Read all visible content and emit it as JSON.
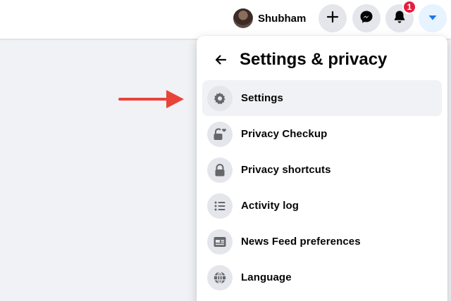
{
  "topbar": {
    "profile_name": "Shubham",
    "notification_count": "1",
    "icons": [
      "plus-icon",
      "messenger-icon",
      "bell-icon",
      "caret-down-icon"
    ]
  },
  "menu": {
    "title": "Settings & privacy",
    "items": [
      {
        "label": "Settings",
        "icon": "gear-icon"
      },
      {
        "label": "Privacy Checkup",
        "icon": "lock-heart-icon"
      },
      {
        "label": "Privacy shortcuts",
        "icon": "lock-icon"
      },
      {
        "label": "Activity log",
        "icon": "list-icon"
      },
      {
        "label": "News Feed preferences",
        "icon": "feed-icon"
      },
      {
        "label": "Language",
        "icon": "globe-icon"
      }
    ]
  },
  "colors": {
    "accent": "#1877f2",
    "annotation_arrow": "#e8443a",
    "badge": "#e41e3f",
    "icon_gray": "#65676b"
  }
}
